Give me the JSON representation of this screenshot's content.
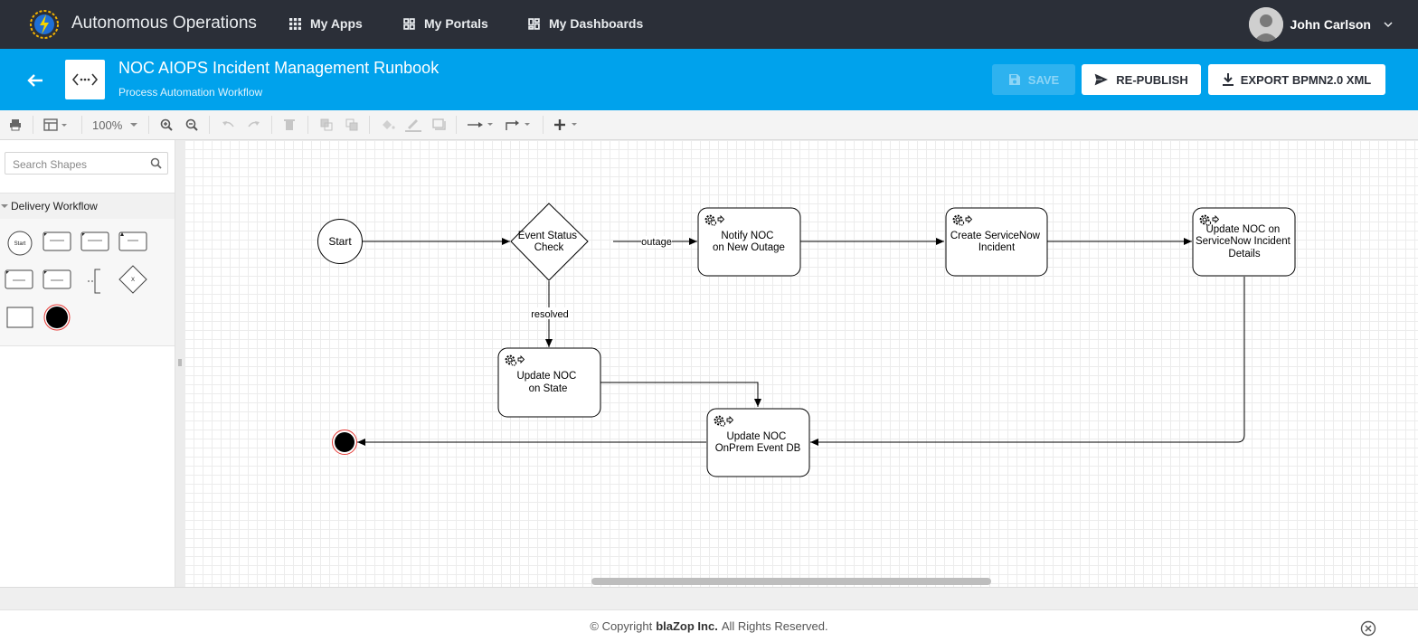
{
  "app": {
    "name": "Autonomous Operations"
  },
  "nav": [
    {
      "label": "My Apps"
    },
    {
      "label": "My Portals"
    },
    {
      "label": "My Dashboards"
    }
  ],
  "user": {
    "name": "John Carlson"
  },
  "header": {
    "title": "NOC AIOPS Incident Management Runbook",
    "subtitle": "Process Automation Workflow",
    "save_label": "SAVE",
    "republish_label": "RE-PUBLISH",
    "export_label": "EXPORT BPMN2.0 XML"
  },
  "toolbar": {
    "zoom": "100%"
  },
  "sidebar": {
    "search_placeholder": "Search Shapes",
    "section_title": "Delivery Workflow",
    "shape_labels": {
      "start": "Start",
      "diamond": "X"
    }
  },
  "diagram": {
    "nodes": {
      "start": "Start",
      "gateway": [
        "Event Status",
        "Check"
      ],
      "notify": [
        "Notify NOC",
        "on New Outage"
      ],
      "create": [
        "Create ServiceNow",
        "Incident"
      ],
      "update_details": [
        "Update NOC on",
        "ServiceNow Incident",
        "Details"
      ],
      "update_state": [
        "Update NOC",
        "on State"
      ],
      "update_db": [
        "Update NOC",
        "OnPrem Event DB"
      ]
    },
    "edges": {
      "outage": "outage",
      "resolved": "resolved"
    }
  },
  "footer": {
    "prefix": "© Copyright ",
    "company": "blaZop Inc.",
    "suffix": " All Rights Reserved."
  },
  "colors": {
    "topbar": "#2b2f38",
    "header": "#00a2ec",
    "end_event_border": "#e53935"
  }
}
